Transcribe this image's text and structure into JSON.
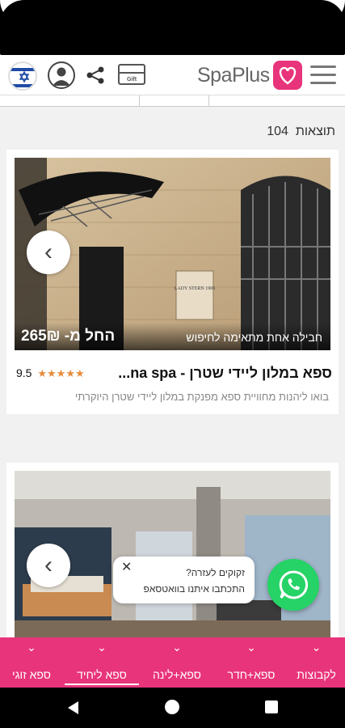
{
  "header": {
    "brand": "SpaPlus",
    "gift_label": "Gift"
  },
  "results": {
    "count": "104",
    "label": "תוצאות"
  },
  "cards": [
    {
      "price": "החל מ- 265₪",
      "caption": "חבילה אחת מתאימה לחיפוש",
      "title": "ספא במלון ליידי שטרן - na spa...",
      "rating": "9.5",
      "stars": "★★★★★",
      "description": "בואו ליהנות מחוויית ספא מפנקת במלון ליידי שטרן היוקרתי",
      "photo_sign": "LADY STERN 1906"
    },
    {}
  ],
  "whatsapp": {
    "line1": "זקוקים לעזרה?",
    "line2": "התכתבו איתנו בוואטסאפ"
  },
  "bottom_nav": [
    {
      "label": "ספא זוגי"
    },
    {
      "label": "ספא ליחיד"
    },
    {
      "label": "ספא+לינה"
    },
    {
      "label": "ספא+חדר"
    },
    {
      "label": "לקבוצות"
    }
  ],
  "colors": {
    "accent": "#e8347a",
    "whatsapp": "#25d366",
    "star": "#e88b3a"
  }
}
